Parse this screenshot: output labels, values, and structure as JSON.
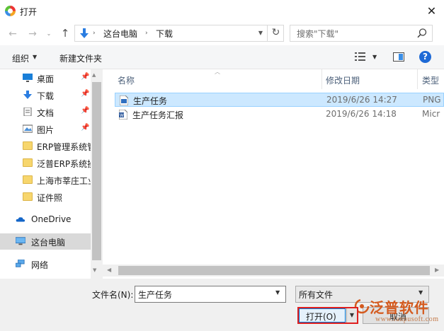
{
  "window": {
    "title": "打开",
    "close_glyph": "✕"
  },
  "nav": {
    "back_glyph": "←",
    "forward_glyph": "→",
    "recent_glyph": "⌄",
    "up_glyph": "↑",
    "refresh_glyph": "↻",
    "address": [
      "这台电脑",
      "下载"
    ],
    "address_separator": "›",
    "search_placeholder": "搜索\"下载\""
  },
  "toolbar": {
    "organize_label": "组织",
    "new_folder_label": "新建文件夹",
    "help_glyph": "?"
  },
  "sidebar": {
    "items": [
      {
        "label": "桌面",
        "icon": "desktop-icon",
        "pinned": true
      },
      {
        "label": "下载",
        "icon": "download-icon",
        "pinned": true
      },
      {
        "label": "文档",
        "icon": "document-icon",
        "pinned": true
      },
      {
        "label": "图片",
        "icon": "picture-icon",
        "pinned": true
      },
      {
        "label": "ERP管理系统管",
        "icon": "folder-icon",
        "pinned": false
      },
      {
        "label": "泛普ERP系统操",
        "icon": "folder-icon",
        "pinned": false
      },
      {
        "label": "上海市莘庄工业",
        "icon": "folder-icon",
        "pinned": false
      },
      {
        "label": "证件照",
        "icon": "folder-icon",
        "pinned": false
      },
      {
        "label": "OneDrive",
        "icon": "onedrive-icon",
        "pinned": false
      },
      {
        "label": "这台电脑",
        "icon": "this-pc-icon",
        "pinned": false,
        "selected": true
      },
      {
        "label": "网络",
        "icon": "network-icon",
        "pinned": false
      }
    ],
    "pin_glyph": "📌"
  },
  "file_list": {
    "columns": [
      "名称",
      "修改日期",
      "类型"
    ],
    "rows": [
      {
        "name": "生产任务",
        "modified": "2019/6/26 14:27",
        "type": "PNG",
        "icon": "png-file-icon",
        "selected": true
      },
      {
        "name": "生产任务汇报",
        "modified": "2019/6/26 14:18",
        "type": "Micr",
        "icon": "word-file-icon",
        "selected": false
      }
    ]
  },
  "footer": {
    "filename_label": "文件名(N):",
    "filename_value": "生产任务",
    "filetype_value": "所有文件",
    "open_label": "打开(O)",
    "cancel_label": "取消"
  },
  "watermark": {
    "text": "泛普软件",
    "url": "www.fanpusoft.com"
  },
  "colors": {
    "accent": "#0078d7",
    "selection": "#cce8ff",
    "highlight_border": "#e02020",
    "watermark": "#d45a1e"
  }
}
